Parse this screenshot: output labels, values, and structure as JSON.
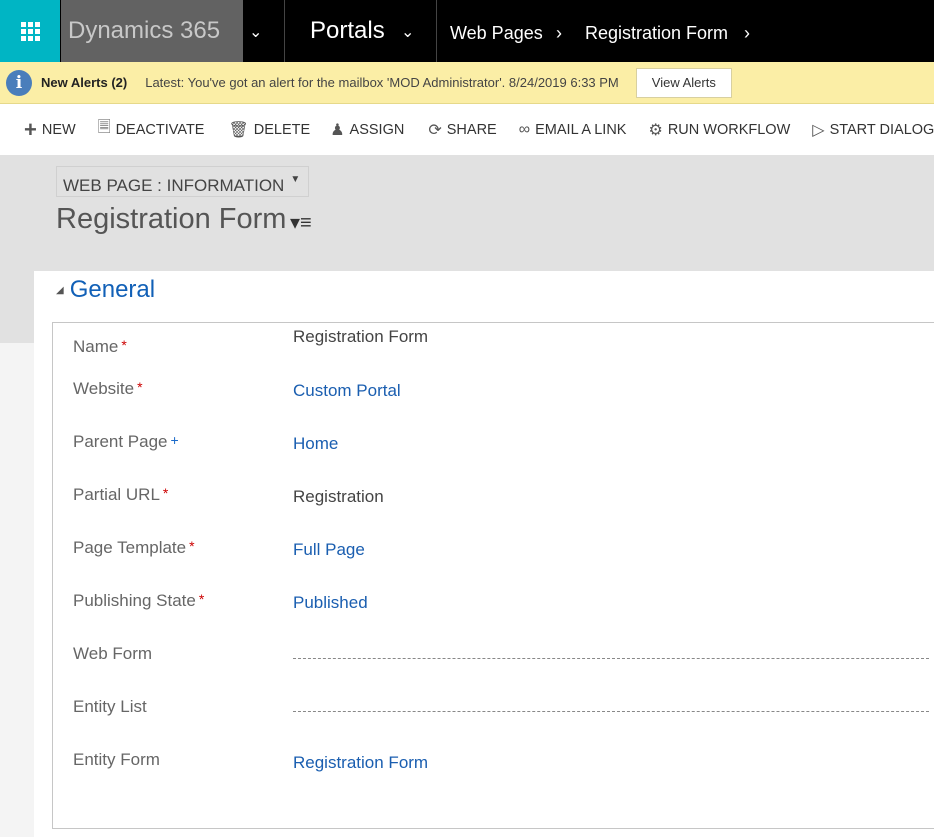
{
  "nav": {
    "brand": "Dynamics 365",
    "area": "Portals",
    "breadcrumbs": [
      "Web Pages",
      "Registration Form"
    ]
  },
  "alert": {
    "title": "New Alerts (2)",
    "message": "Latest: You've got an alert for the mailbox 'MOD Administrator'. 8/24/2019 6:33 PM",
    "button": "View Alerts"
  },
  "commands": [
    {
      "label": "NEW",
      "icon": "plus-icon"
    },
    {
      "label": "DEACTIVATE",
      "icon": "deactivate-icon"
    },
    {
      "label": "DELETE",
      "icon": "trash-icon"
    },
    {
      "label": "ASSIGN",
      "icon": "assign-icon"
    },
    {
      "label": "SHARE",
      "icon": "share-icon"
    },
    {
      "label": "EMAIL A LINK",
      "icon": "link-icon"
    },
    {
      "label": "RUN WORKFLOW",
      "icon": "workflow-icon"
    },
    {
      "label": "START DIALOG",
      "icon": "dialog-icon"
    }
  ],
  "header": {
    "form_selector": "WEB PAGE : INFORMATION",
    "record_title": "Registration Form"
  },
  "section": {
    "title": "General",
    "fields": [
      {
        "label": "Name",
        "required": "*",
        "value": "Registration Form"
      },
      {
        "label": "Website",
        "required": "*",
        "value": "Custom Portal"
      },
      {
        "label": "Parent Page",
        "recommended": "+",
        "value": "Home"
      },
      {
        "label": "Partial URL",
        "required": "*",
        "value": "Registration"
      },
      {
        "label": "Page Template",
        "required": "*",
        "value": "Full Page"
      },
      {
        "label": "Publishing State",
        "required": "*",
        "value": "Published"
      },
      {
        "label": "Web Form",
        "value": ""
      },
      {
        "label": "Entity List",
        "value": ""
      },
      {
        "label": "Entity Form",
        "value": "Registration Form"
      }
    ]
  }
}
